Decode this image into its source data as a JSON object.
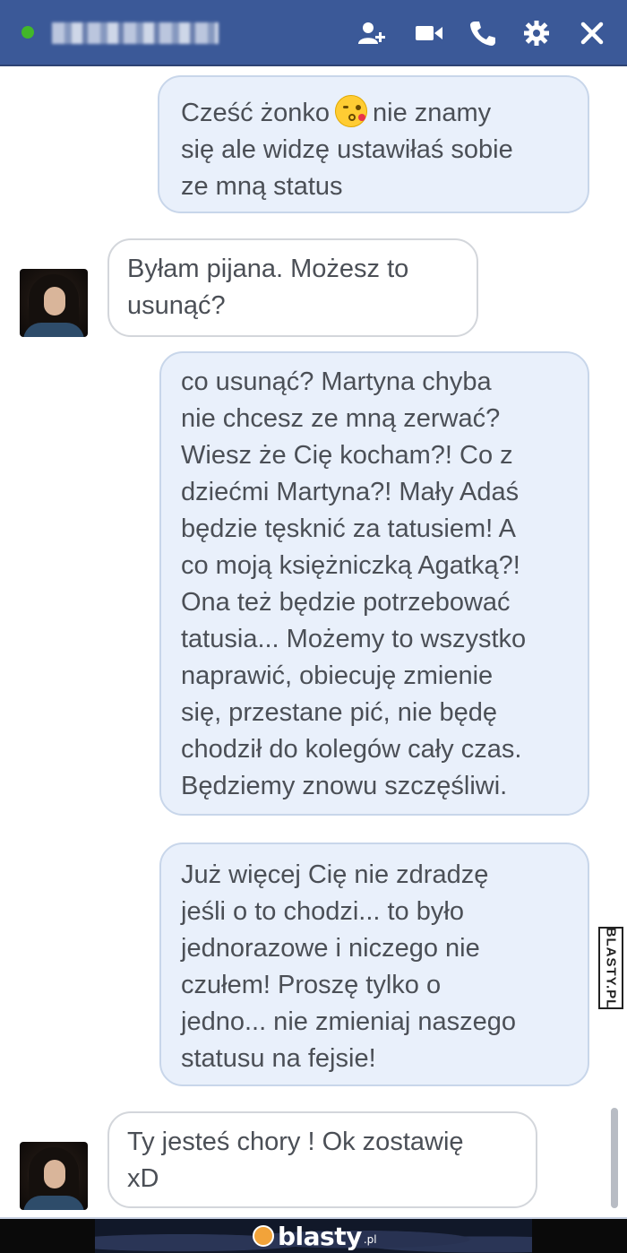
{
  "header": {
    "contact_name_redacted": true,
    "icons": [
      "add-friend-icon",
      "video-call-icon",
      "phone-icon",
      "gear-icon",
      "close-icon"
    ]
  },
  "messages": [
    {
      "sender": "me",
      "lines": [
        "Cześć żonko",
        "nie znamy",
        "się ale widzę ustawiłaś sobie",
        "ze mną status"
      ],
      "emoji": "kissing-face-icon"
    },
    {
      "sender": "them",
      "lines": [
        "Byłam pijana. Możesz to",
        "usunąć?"
      ]
    },
    {
      "sender": "me",
      "lines": [
        "co usunąć? Martyna chyba",
        "nie chcesz ze mną zerwać?",
        "Wiesz że Cię kocham?! Co z",
        "dziećmi Martyna?! Mały Adaś",
        "będzie tęsknić za tatusiem! A",
        "co moją księżniczką Agatką?!",
        "Ona też będzie potrzebować",
        "tatusia... Możemy to wszystko",
        "naprawić, obiecuję zmienie",
        "się, przestane pić, nie będę",
        "chodził do kolegów cały czas.",
        "Będziemy znowu szczęśliwi."
      ]
    },
    {
      "sender": "me",
      "lines": [
        "Już więcej Cię nie zdradzę",
        "jeśli o to chodzi... to było",
        "jednorazowe i niczego nie",
        "czułem! Proszę tylko o",
        "jedno... nie zmieniaj naszego",
        "statusu na fejsie!"
      ]
    },
    {
      "sender": "them",
      "lines": [
        "Ty jesteś chory ! Ok zostawię",
        "xD"
      ]
    }
  ],
  "watermark": {
    "side_text": "BLASTY.PL"
  },
  "footer": {
    "logo_text": "blasty",
    "logo_tld": ".pl"
  },
  "colors": {
    "header": "#3b5998",
    "my_bubble": "#e9f0fb",
    "their_bubble": "#ffffff",
    "online": "#42b72a"
  }
}
